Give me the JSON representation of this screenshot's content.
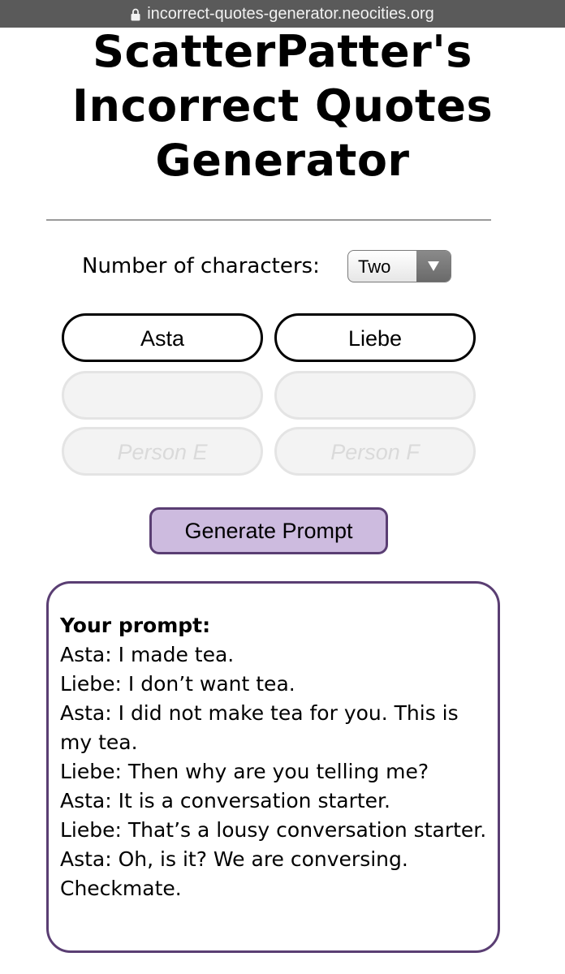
{
  "browser": {
    "url": "incorrect-quotes-generator.neocities.org"
  },
  "page": {
    "title_lines": [
      "ScatterPatter's",
      "Incorrect Quotes",
      "Generator"
    ]
  },
  "controls": {
    "num_characters_label": "Number of characters:",
    "num_characters_value": "Two",
    "inputs": [
      {
        "value": "Asta",
        "placeholder": "",
        "active": true
      },
      {
        "value": "Liebe",
        "placeholder": "",
        "active": true
      },
      {
        "value": "",
        "placeholder": "",
        "active": false
      },
      {
        "value": "",
        "placeholder": "",
        "active": false
      },
      {
        "value": "",
        "placeholder": "Person E",
        "active": false
      },
      {
        "value": "",
        "placeholder": "Person F",
        "active": false
      }
    ],
    "generate_label": "Generate Prompt"
  },
  "prompt": {
    "heading": "Your prompt:",
    "lines": [
      "Asta: I made tea.",
      "Liebe: I don’t want tea.",
      "Asta: I did not make tea for you. This is my tea.",
      "Liebe: Then why are you telling me?",
      "Asta: It is a conversation starter.",
      "Liebe: That’s a lousy conversation starter.",
      "Asta: Oh, is it? We are conversing. Checkmate."
    ]
  },
  "colors": {
    "accent_border": "#5a3e73",
    "button_fill": "#cdbbdf",
    "url_bar": "#5a5a5a"
  },
  "icons": {
    "url_bar": "lock-icon",
    "select": "triangle-down-icon"
  }
}
